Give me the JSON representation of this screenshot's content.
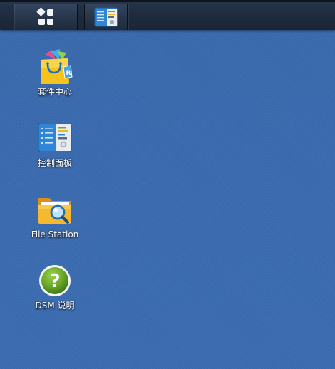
{
  "taskbar": {
    "main_menu_icon": "main-menu-icon",
    "open_app_icon": "control-panel-icon"
  },
  "desktop": {
    "icons": [
      {
        "label": "套件中心",
        "icon": "package-center-icon"
      },
      {
        "label": "控制面板",
        "icon": "control-panel-icon"
      },
      {
        "label": "File Station",
        "icon": "file-station-icon"
      },
      {
        "label": "DSM 说明",
        "icon": "help-icon"
      }
    ]
  },
  "colors": {
    "desktop_bg": "#3a6aae",
    "taskbar_bg": "#1f2c3e",
    "help_green": "#6aa62a"
  }
}
